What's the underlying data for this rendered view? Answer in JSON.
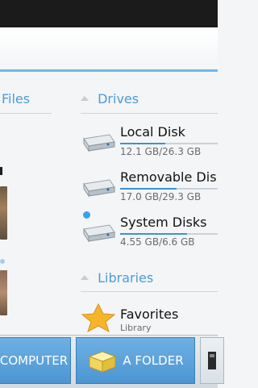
{
  "sections": {
    "files_label": "Files",
    "drives_label": "Drives",
    "libraries_label": "Libraries"
  },
  "drives": [
    {
      "name": "Local Disk",
      "size": "12.1 GB/26.3 GB",
      "used_fraction": 0.46
    },
    {
      "name": "Removable Dis",
      "size": "17.0 GB/29.3 GB",
      "used_fraction": 0.58
    },
    {
      "name": "System Disks",
      "size": "4.55 GB/6.6 GB",
      "used_fraction": 0.69
    }
  ],
  "libraries": [
    {
      "name": "Favorites",
      "sub": "Library"
    }
  ],
  "bottom_buttons": {
    "computer": "COMPUTER",
    "folder": "A FOLDER"
  },
  "colors": {
    "accent": "#4a9bd8",
    "button": "#5ea3dc",
    "status_bar": "#1b1b1b"
  }
}
